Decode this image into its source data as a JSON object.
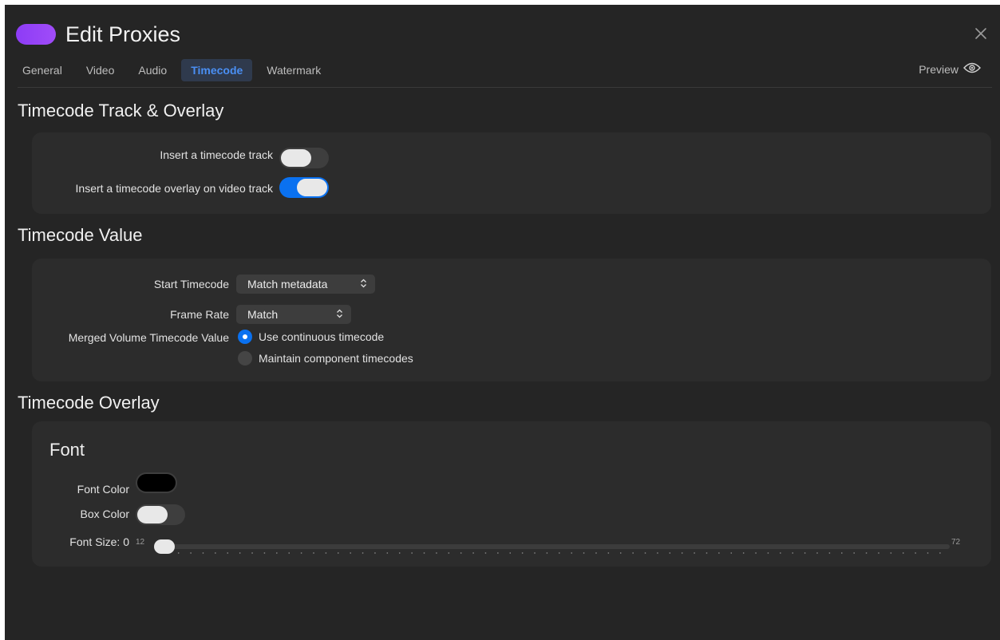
{
  "window": {
    "title": "Edit Proxies",
    "accent": "#8d3cf6"
  },
  "tabs": [
    {
      "label": "General"
    },
    {
      "label": "Video"
    },
    {
      "label": "Audio"
    },
    {
      "label": "Timecode",
      "active": true
    },
    {
      "label": "Watermark"
    }
  ],
  "preview": {
    "label": "Preview",
    "icon": "eye-icon"
  },
  "track_overlay": {
    "title": "Timecode Track & Overlay",
    "insert_track": {
      "label": "Insert a timecode track",
      "on": false
    },
    "insert_overlay": {
      "label": "Insert a timecode overlay on video track",
      "on": true
    }
  },
  "timecode_value": {
    "title": "Timecode Value",
    "start": {
      "label": "Start Timecode",
      "value": "Match metadata"
    },
    "frame_rate": {
      "label": "Frame Rate",
      "value": "Match"
    },
    "merged": {
      "label": "Merged Volume Timecode Value",
      "options": [
        {
          "label": "Use continuous timecode",
          "selected": true
        },
        {
          "label": "Maintain component timecodes",
          "selected": false
        }
      ]
    }
  },
  "overlay": {
    "title": "Timecode Overlay",
    "font_heading": "Font",
    "font_color": {
      "label": "Font Color",
      "color": "#000000"
    },
    "box_color": {
      "label": "Box Color",
      "on": false
    },
    "font_size": {
      "label": "Font Size: 0",
      "min": "12",
      "max": "72",
      "value": 0
    }
  }
}
